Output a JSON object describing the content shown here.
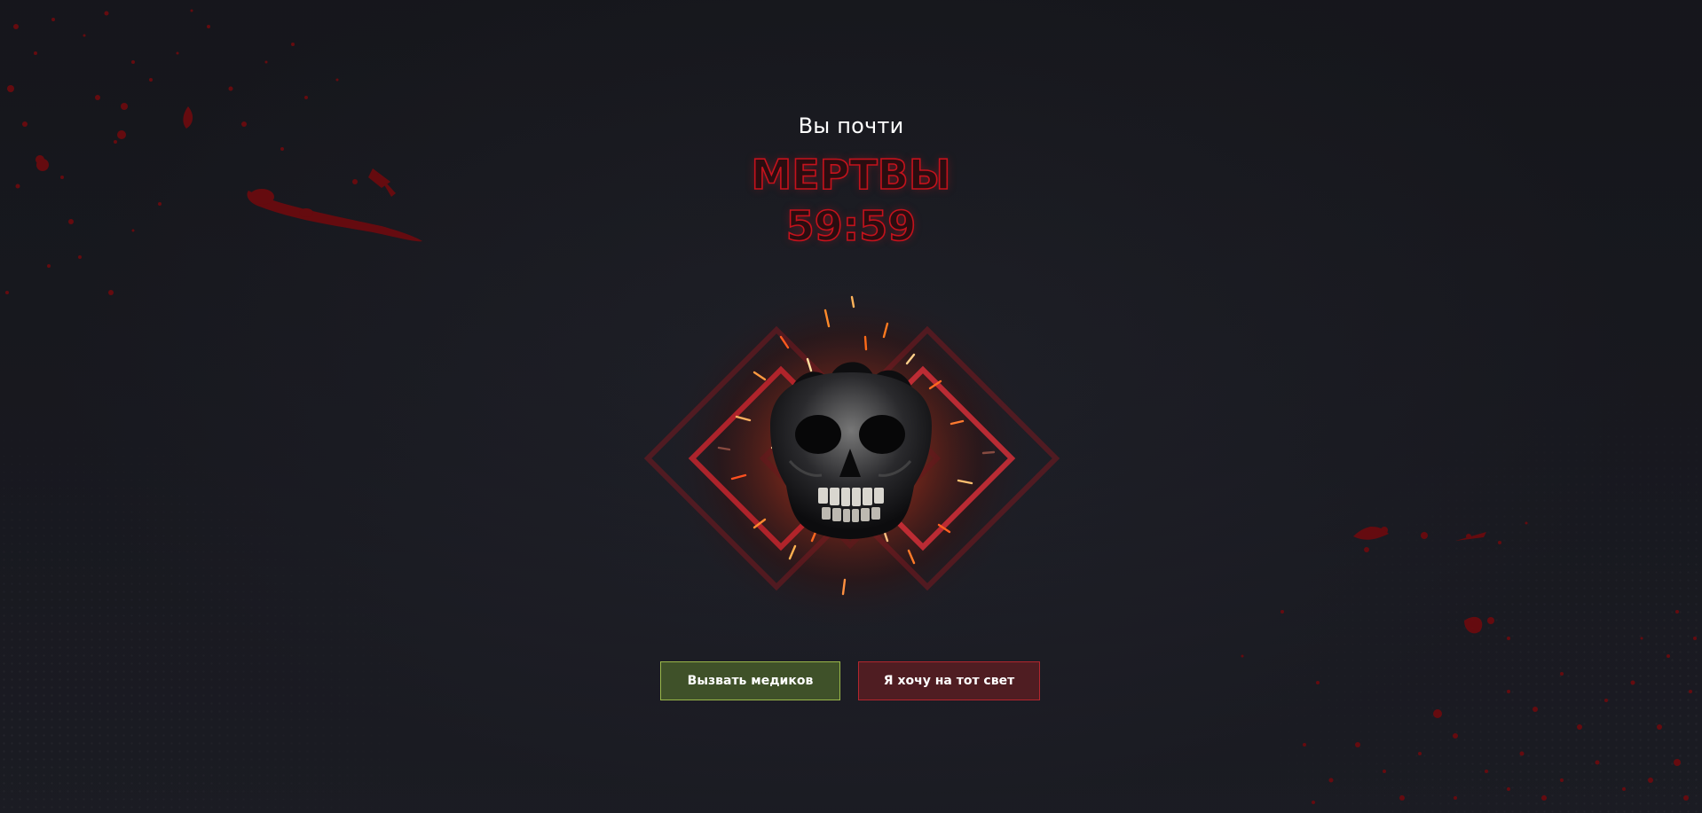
{
  "screen": {
    "subtitle": "Вы почти",
    "title": "МЕРТВЫ",
    "timer": "59:59"
  },
  "emblem": {
    "icon": "skull-icon"
  },
  "buttons": {
    "medics_label": "Вызвать медиков",
    "die_label": "Я хочу на тот свет"
  },
  "colors": {
    "background": "#1f2028",
    "title_outline": "#c5121c",
    "medics_button": "#3f5129",
    "medics_border": "#9bb84a",
    "die_button": "#4f1d22",
    "die_border": "#b3262e",
    "blood": "#7a0c10"
  }
}
